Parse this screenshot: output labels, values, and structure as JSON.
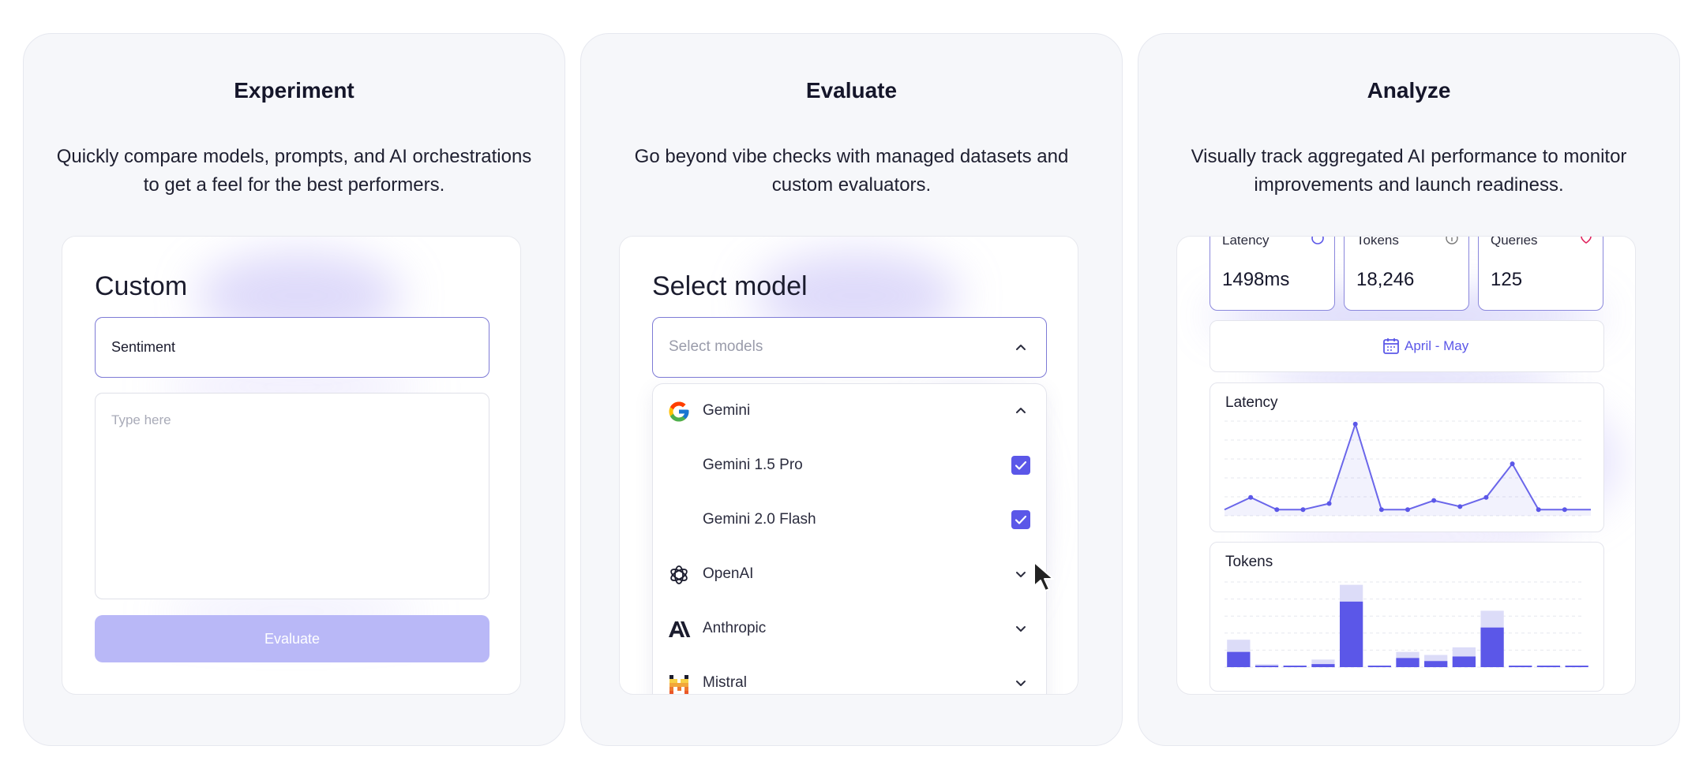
{
  "panels": {
    "experiment": {
      "title": "Experiment",
      "description": "Quickly compare models, prompts, and AI orchestrations to get a feel for the best performers.",
      "card_title": "Custom",
      "name_value": "Sentiment",
      "text_placeholder": "Type here",
      "button_label": "Evaluate"
    },
    "evaluate": {
      "title": "Evaluate",
      "description": "Go beyond vibe checks with managed datasets and custom evaluators.",
      "card_title": "Select model",
      "select_placeholder": "Select models",
      "providers": [
        {
          "label": "Gemini",
          "expanded": true,
          "icon": "google-icon"
        },
        {
          "label": "OpenAI",
          "expanded": false,
          "icon": "openai-icon"
        },
        {
          "label": "Anthropic",
          "expanded": false,
          "icon": "anthropic-icon"
        },
        {
          "label": "Mistral",
          "expanded": false,
          "icon": "mistral-icon"
        }
      ],
      "models": [
        {
          "label": "Gemini 1.5 Pro",
          "checked": true
        },
        {
          "label": "Gemini 2.0 Flash",
          "checked": true
        }
      ]
    },
    "analyze": {
      "title": "Analyze",
      "description": "Visually track aggregated AI performance to monitor improvements and launch readiness.",
      "stats": [
        {
          "label": "Latency",
          "value": "1498ms",
          "icon": "clock-icon"
        },
        {
          "label": "Tokens",
          "value": "18,246",
          "icon": "info-icon"
        },
        {
          "label": "Queries",
          "value": "125",
          "icon": "heart-icon"
        }
      ],
      "date_range": "April - May"
    }
  },
  "colors": {
    "accent": "#5b57e8",
    "accent_light": "#b9b8f7",
    "panel_bg": "#f6f7fa",
    "token_light": "#dcdcf8"
  },
  "chart_data": [
    {
      "type": "line",
      "title": "Latency",
      "x": [
        1,
        2,
        3,
        4,
        5,
        6,
        7,
        8,
        9,
        10,
        11,
        12,
        13,
        14,
        15
      ],
      "values": [
        2,
        6,
        2,
        2,
        4,
        30,
        2,
        2,
        5,
        3,
        6,
        17,
        2,
        2,
        2
      ],
      "ylim": [
        0,
        32
      ],
      "grid": true
    },
    {
      "type": "bar",
      "title": "Tokens",
      "x": [
        1,
        2,
        3,
        4,
        5,
        6,
        7,
        8,
        9,
        10,
        11,
        12,
        13
      ],
      "series": [
        {
          "values": [
            5,
            0.5,
            0.5,
            1,
            21.5,
            0.5,
            3,
            2,
            3.5,
            13,
            0.5,
            0.5,
            0.5
          ]
        },
        {
          "values": [
            9,
            1,
            0.5,
            2.5,
            27,
            0.5,
            5,
            4,
            6.5,
            18.5,
            0.5,
            0.5,
            0.5
          ]
        }
      ],
      "ylim": [
        0,
        30
      ],
      "grid": true
    }
  ]
}
